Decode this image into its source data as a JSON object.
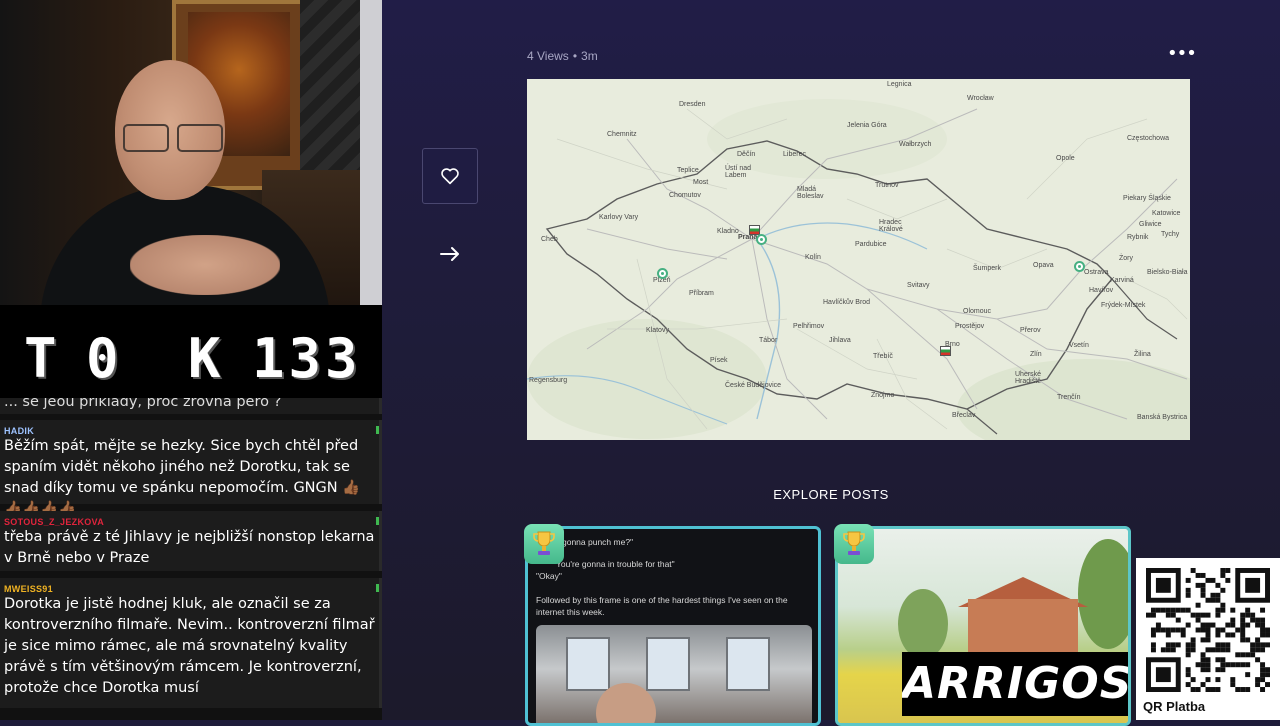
{
  "stream_overlay": {
    "counter": {
      "t_label": "T",
      "t_value": "0",
      "k_label": "K",
      "k_value": "133"
    },
    "chat": [
      {
        "user": "",
        "user_color": "#dddddd",
        "text": "... se jeou priklady, proc zrovna pero ?"
      },
      {
        "user": "HADIK",
        "user_color": "#9ec3ff",
        "text": "Běžím spát, mějte se hezky. Sice bych chtěl před spaním vidět někoho jiného než Dorotku, tak se snad díky tomu ve spánku nepomočím. GNGN 👍🏾👍🏾👍🏾👍🏾👍🏾"
      },
      {
        "user": "SOTOUS_Z_JEZKOVA",
        "user_color": "#e0243c",
        "text": "třeba právě z té Jihlavy je nejbližší nonstop lekarna v Brně nebo v Praze"
      },
      {
        "user": "MWEISS91",
        "user_color": "#f0b323",
        "text": "Dorotka je jistě hodnej kluk, ale označil se za kontroverzního filmaře. Nevim.. kontroverzní filmař je sice mimo rámec, ale má srovnatelný kvality právě s tím většinovým rámcem. Je kontroverzní, protože chce Dorotka musí"
      }
    ]
  },
  "post": {
    "views": "4 Views",
    "age": "3m",
    "more_icon": "•••",
    "like_icon": "heart-icon",
    "share_icon": "share-arrow-icon"
  },
  "map": {
    "cities": [
      {
        "name": "Legnica"
      },
      {
        "name": "Wrocław"
      },
      {
        "name": "Dresden"
      },
      {
        "name": "Jelenia Góra"
      },
      {
        "name": "Wałbrzych"
      },
      {
        "name": "Częstochowa"
      },
      {
        "name": "Chemnitz"
      },
      {
        "name": "Děčín"
      },
      {
        "name": "Liberec"
      },
      {
        "name": "Opole"
      },
      {
        "name": "Teplice"
      },
      {
        "name": "Ústí nad Labem"
      },
      {
        "name": "Most"
      },
      {
        "name": "Chomutov"
      },
      {
        "name": "Mladá Boleslav"
      },
      {
        "name": "Trutnov"
      },
      {
        "name": "Piekary Śląskie"
      },
      {
        "name": "Katowice"
      },
      {
        "name": "Karlovy Vary"
      },
      {
        "name": "Gliwice"
      },
      {
        "name": "Tychy"
      },
      {
        "name": "Cheb"
      },
      {
        "name": "Kladno"
      },
      {
        "name": "Praha"
      },
      {
        "name": "Hradec Králové"
      },
      {
        "name": "Pardubice"
      },
      {
        "name": "Rybnik"
      },
      {
        "name": "Kolín"
      },
      {
        "name": "Opava"
      },
      {
        "name": "Ostrava"
      },
      {
        "name": "Żory"
      },
      {
        "name": "Bielsko-Biała"
      },
      {
        "name": "Karviná"
      },
      {
        "name": "Havířov"
      },
      {
        "name": "Frýdek-Místek"
      },
      {
        "name": "Plzeň"
      },
      {
        "name": "Šumperk"
      },
      {
        "name": "Svitavy"
      },
      {
        "name": "Příbram"
      },
      {
        "name": "Havlíčkův Brod"
      },
      {
        "name": "Olomouc"
      },
      {
        "name": "Klatovy"
      },
      {
        "name": "Pelhřimov"
      },
      {
        "name": "Prostějov"
      },
      {
        "name": "Přerov"
      },
      {
        "name": "Vsetín"
      },
      {
        "name": "Tábor"
      },
      {
        "name": "Jihlava"
      },
      {
        "name": "Třebíč"
      },
      {
        "name": "Brno"
      },
      {
        "name": "Zlín"
      },
      {
        "name": "Žilina"
      },
      {
        "name": "Písek"
      },
      {
        "name": "Uherské Hradiště"
      },
      {
        "name": "Regensburg"
      },
      {
        "name": "České Budějovice"
      },
      {
        "name": "Znojmo"
      },
      {
        "name": "Trenčín"
      },
      {
        "name": "Břeclav"
      },
      {
        "name": "Banská Bystrica"
      }
    ]
  },
  "explore": {
    "title": "EXPLORE POSTS",
    "posts": [
      {
        "lines": [
          "gonna punch me?\"",
          "You're gonna in trouble for that\"",
          "\"Okay\"",
          "Followed by this frame is one of the hardest things I've seen on the",
          "internet this week."
        ]
      },
      {
        "lines": []
      }
    ],
    "badge_icon": "trophy-icon"
  },
  "sponsor_logo": "ARRIGOS",
  "qr": {
    "label": "QR Platba"
  }
}
